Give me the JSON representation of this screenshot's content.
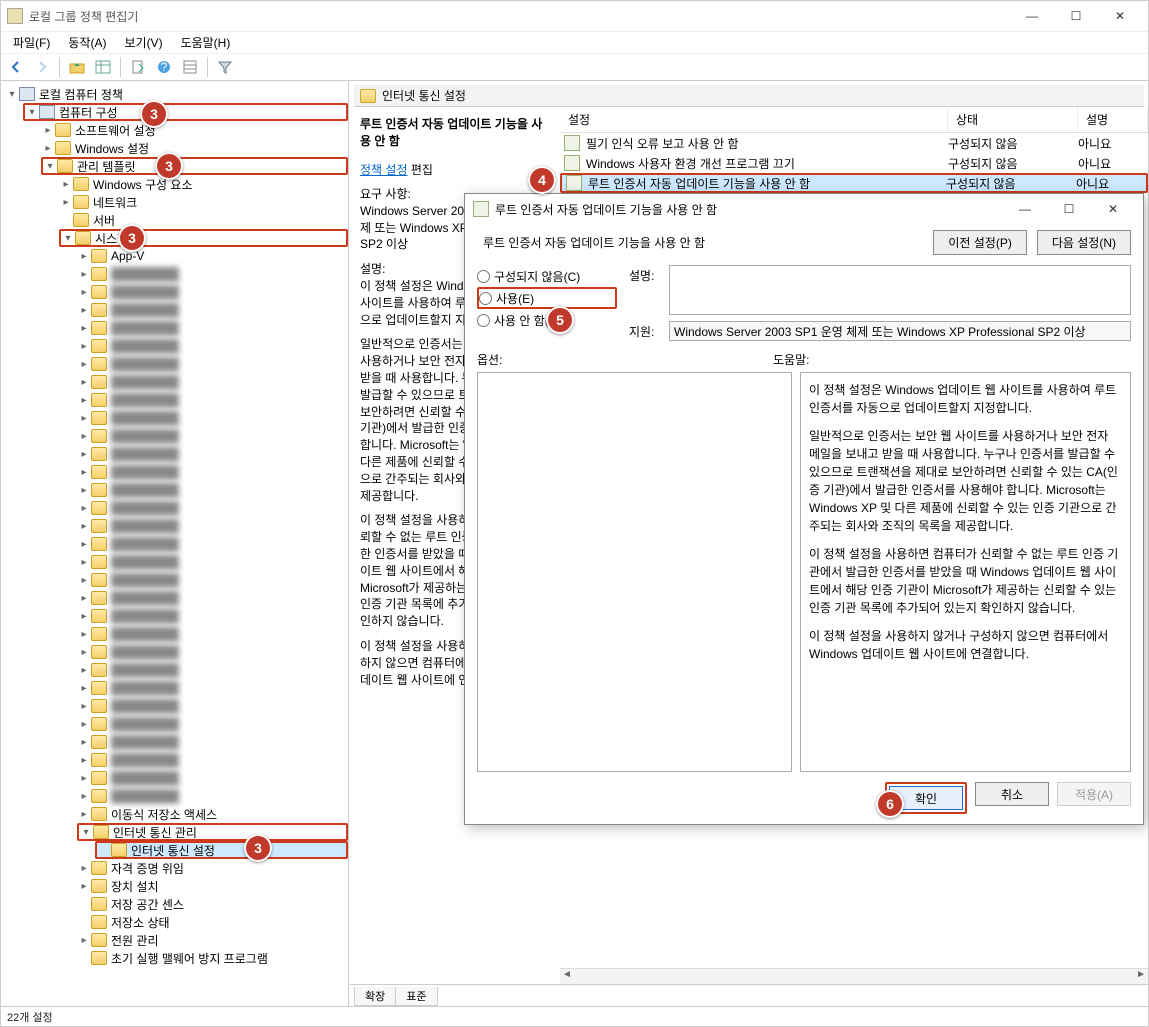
{
  "window": {
    "title": "로컬 그룹 정책 편집기",
    "min": "—",
    "max": "☐",
    "close": "✕"
  },
  "menu": {
    "file": "파일(F)",
    "action": "동작(A)",
    "view": "보기(V)",
    "help": "도움말(H)"
  },
  "toolbar_icons": [
    "back",
    "forward",
    "|",
    "up",
    "table",
    "|",
    "doc",
    "help",
    "grid",
    "|",
    "filter"
  ],
  "tree": {
    "root": "로컬 컴퓨터 정책",
    "n1": "컴퓨터 구성",
    "n2": "소프트웨어 설정",
    "n3": "Windows 설정",
    "n4": "관리 템플릿",
    "n5": "Windows 구성 요소",
    "n6": "네트워크",
    "n7": "서버",
    "n8": "시스템",
    "n9": "App-V",
    "blur_count": 30,
    "n10": "이동식 저장소 액세스",
    "n11": "인터넷 통신 관리",
    "n12": "인터넷 통신 설정",
    "n13": "자격 증명 위임",
    "n14": "장치 설치",
    "n15": "저장 공간 센스",
    "n16": "저장소 상태",
    "n17": "전원 관리",
    "n18": "초기 실행 맬웨어 방지 프로그램"
  },
  "right": {
    "path": "인터넷 통신 설정",
    "desc_title": "루트 인증서 자동 업데이트 기능을 사용 안 함",
    "desc_link": "정책 설정",
    "desc_link_suffix": " 편집",
    "req_label": "요구 사항:",
    "req_text": "Windows Server 2003 SP1 운영 체제 또는 Windows XP Professional SP2 이상",
    "desc_label": "설명:",
    "desc_p1": "이 정책 설정은 Windows 업데이트 웹 사이트를 사용하여 루트 인증서를 자동으로 업데이트할지 지정합니다.",
    "desc_p2": "일반적으로 인증서는 보안 웹 사이트를 사용하거나 보안 전자 메일을 보내고 받을 때 사용합니다. 누구나 인증서를 발급할 수 있으므로 트랜잭션을 제대로 보안하려면 신뢰할 수 있는 CA(인증 기관)에서 발급한 인증서를 사용해야 합니다. Microsoft는 Windows XP 및 다른 제품에 신뢰할 수 있는 인증 기관으로 간주되는 회사와 조직의 목록을 제공합니다.",
    "desc_p3": "이 정책 설정을 사용하면 컴퓨터가 신뢰할 수 없는 루트 인증 기관에서 발급한 인증서를 받았을 때 Windows 업데이트 웹 사이트에서 해당 인증 기관이 Microsoft가 제공하는 신뢰할 수 있는 인증 기관 목록에 추가되어 있는지 확인하지 않습니다.",
    "desc_p4": "이 정책 설정을 사용하지 않거나 구성하지 않으면 컴퓨터에서 Windows 업데이트 웹 사이트에 연결합니다."
  },
  "list": {
    "cols": {
      "setting": "설정",
      "state": "상태",
      "desc": "설명"
    },
    "rows": [
      {
        "name": "필기 인식 오류 보고 사용 안 함",
        "state": "구성되지 않음",
        "desc": "아니요"
      },
      {
        "name": "Windows 사용자 환경 개선 프로그램 끄기",
        "state": "구성되지 않음",
        "desc": "아니요"
      },
      {
        "name": "루트 인증서 자동 업데이트 기능을 사용 안 함",
        "state": "구성되지 않음",
        "desc": "아니요"
      }
    ]
  },
  "dlg": {
    "title": "루트 인증서 자동 업데이트 기능을 사용 안 함",
    "heading": "루트 인증서 자동 업데이트 기능을 사용 안 함",
    "prev_btn": "이전 설정(P)",
    "next_btn": "다음 설정(N)",
    "r_notconf": "구성되지 않음(C)",
    "r_enable": "사용(E)",
    "r_disable": "사용 안 함(D)",
    "lbl_desc": "설명:",
    "lbl_support": "지원:",
    "support_text": "Windows Server 2003 SP1 운영 체제 또는 Windows XP Professional SP2 이상",
    "lbl_options": "옵션:",
    "lbl_help": "도움말:",
    "help_p1": "이 정책 설정은 Windows 업데이트 웹 사이트를 사용하여 루트 인증서를 자동으로 업데이트할지 지정합니다.",
    "help_p2": "일반적으로 인증서는 보안 웹 사이트를 사용하거나 보안 전자 메일을 보내고 받을 때 사용합니다. 누구나 인증서를 발급할 수 있으므로 트랜잭션을 제대로 보안하려면 신뢰할 수 있는 CA(인증 기관)에서 발급한 인증서를 사용해야 합니다. Microsoft는 Windows XP 및 다른 제품에 신뢰할 수 있는 인증 기관으로 간주되는 회사와 조직의 목록을 제공합니다.",
    "help_p3": "이 정책 설정을 사용하면 컴퓨터가 신뢰할 수 없는 루트 인증 기관에서 발급한 인증서를 받았을 때 Windows 업데이트 웹 사이트에서 해당 인증 기관이 Microsoft가 제공하는 신뢰할 수 있는 인증 기관 목록에 추가되어 있는지 확인하지 않습니다.",
    "help_p4": "이 정책 설정을 사용하지 않거나 구성하지 않으면 컴퓨터에서 Windows 업데이트 웹 사이트에 연결합니다.",
    "ok": "확인",
    "cancel": "취소",
    "apply": "적용(A)"
  },
  "tabs": {
    "ext": "확장",
    "std": "표준"
  },
  "status": "22개 설정",
  "callouts": {
    "c3": "3",
    "c4": "4",
    "c5": "5",
    "c6": "6"
  }
}
